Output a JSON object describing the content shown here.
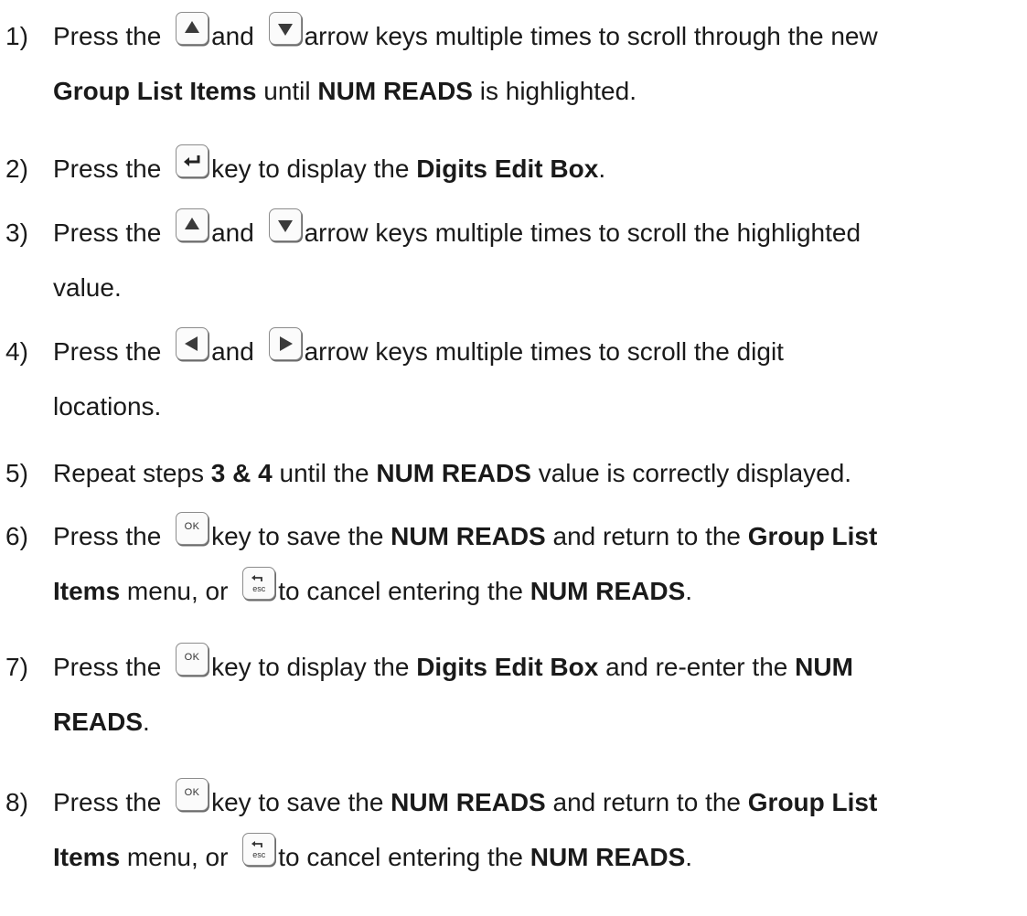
{
  "steps": [
    {
      "num": "1)",
      "lines": [
        [
          {
            "t": "Press the "
          },
          {
            "k": "up"
          },
          {
            "t": "and "
          },
          {
            "k": "down"
          },
          {
            "t": "arrow keys multiple times to scroll through the new"
          }
        ],
        [
          {
            "t": "Group List Items",
            "b": 1
          },
          {
            "t": " until "
          },
          {
            "t": "NUM READS",
            "b": 1
          },
          {
            "t": " is highlighted."
          }
        ]
      ]
    },
    {
      "num": "2)",
      "lines": [
        [
          {
            "t": "Press the "
          },
          {
            "k": "enter"
          },
          {
            "t": "key to display the "
          },
          {
            "t": "Digits Edit Box",
            "b": 1
          },
          {
            "t": "."
          }
        ]
      ]
    },
    {
      "num": "3)",
      "lines": [
        [
          {
            "t": "Press the "
          },
          {
            "k": "up"
          },
          {
            "t": "and "
          },
          {
            "k": "down"
          },
          {
            "t": "arrow keys multiple times to scroll the highlighted"
          }
        ],
        [
          {
            "t": "value."
          }
        ]
      ]
    },
    {
      "num": "4)",
      "lines": [
        [
          {
            "t": "Press the "
          },
          {
            "k": "left"
          },
          {
            "t": "and "
          },
          {
            "k": "right"
          },
          {
            "t": "arrow keys multiple times to scroll the digit"
          }
        ],
        [
          {
            "t": "locations."
          }
        ]
      ]
    },
    {
      "num": "5)",
      "lines": [
        [
          {
            "t": "Repeat steps "
          },
          {
            "t": "3 & 4",
            "b": 1
          },
          {
            "t": " until the "
          },
          {
            "t": "NUM READS",
            "b": 1
          },
          {
            "t": " value is correctly displayed."
          }
        ]
      ]
    },
    {
      "num": "6)",
      "lines": [
        [
          {
            "t": "Press the "
          },
          {
            "k": "ok"
          },
          {
            "t": "key to save the "
          },
          {
            "t": "NUM READS",
            "b": 1
          },
          {
            "t": " and return to the "
          },
          {
            "t": "Group List",
            "b": 1
          }
        ],
        [
          {
            "t": "Items",
            "b": 1
          },
          {
            "t": " menu, or "
          },
          {
            "k": "esc"
          },
          {
            "t": "to cancel entering the "
          },
          {
            "t": "NUM READS",
            "b": 1
          },
          {
            "t": "."
          }
        ]
      ]
    },
    {
      "num": "7)",
      "lines": [
        [
          {
            "t": "Press the "
          },
          {
            "k": "ok"
          },
          {
            "t": "key to display the "
          },
          {
            "t": "Digits Edit Box",
            "b": 1
          },
          {
            "t": " and re-enter the "
          },
          {
            "t": "NUM",
            "b": 1
          }
        ],
        [
          {
            "t": "READS",
            "b": 1
          },
          {
            "t": "."
          }
        ]
      ]
    },
    {
      "num": "8)",
      "lines": [
        [
          {
            "t": "Press the "
          },
          {
            "k": "ok"
          },
          {
            "t": "key to save the "
          },
          {
            "t": "NUM READS",
            "b": 1
          },
          {
            "t": " and return to the "
          },
          {
            "t": "Group List",
            "b": 1
          }
        ],
        [
          {
            "t": "Items",
            "b": 1
          },
          {
            "t": " menu, or "
          },
          {
            "k": "esc"
          },
          {
            "t": "to cancel entering the "
          },
          {
            "t": "NUM READS",
            "b": 1
          },
          {
            "t": "."
          }
        ]
      ]
    }
  ],
  "key_text": {
    "ok": "OK",
    "esc": "esc"
  },
  "icons": {
    "up": "arrow-up-key-icon",
    "down": "arrow-down-key-icon",
    "left": "arrow-left-key-icon",
    "right": "arrow-right-key-icon",
    "enter": "enter-key-icon",
    "ok": "ok-key-icon",
    "esc": "esc-key-icon"
  },
  "colors": {
    "text": "#1a1a1a",
    "key_border": "#8c8c8c",
    "key_glyph": "#3a3a3a"
  }
}
